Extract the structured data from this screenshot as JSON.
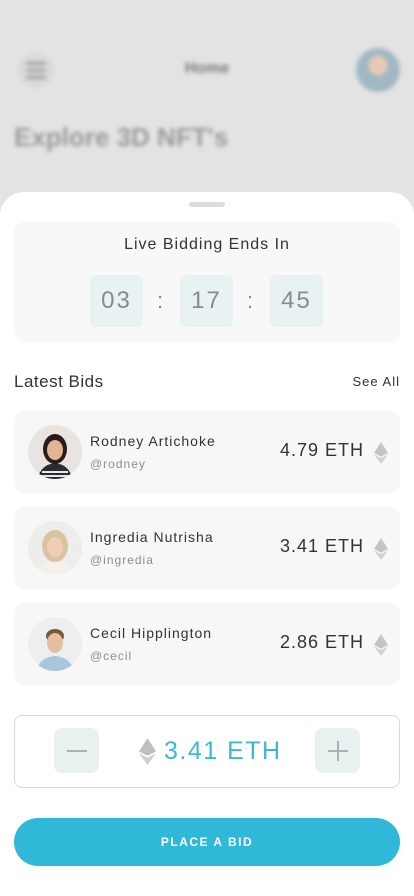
{
  "background": {
    "title": "Home",
    "heading": "Explore 3D NFT's"
  },
  "timer": {
    "title": "Live Bidding Ends In",
    "hours": "03",
    "minutes": "17",
    "seconds": "45",
    "separator": ":"
  },
  "bids": {
    "label": "Latest Bids",
    "see_all": "See All",
    "items": [
      {
        "name": "Rodney Artichoke",
        "handle": "@rodney",
        "amount": "4.79 ETH"
      },
      {
        "name": "Ingredia Nutrisha",
        "handle": "@ingredia",
        "amount": "3.41 ETH"
      },
      {
        "name": "Cecil Hipplington",
        "handle": "@cecil",
        "amount": "2.86 ETH"
      }
    ]
  },
  "bid_input": {
    "value": "3.41 ETH"
  },
  "place_bid_label": "PLACE A BID",
  "colors": {
    "accent": "#30b8d8",
    "amount_text": "#3bb8d3"
  },
  "icons": [
    "menu-icon",
    "eth-icon",
    "minus-icon",
    "plus-icon"
  ]
}
